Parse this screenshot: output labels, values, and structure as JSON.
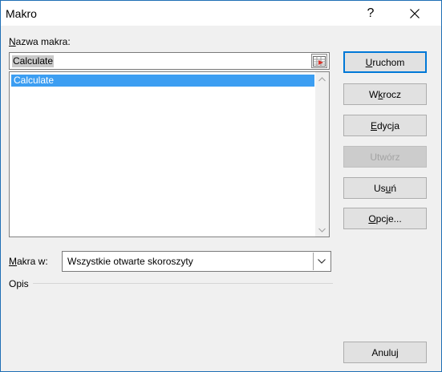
{
  "window": {
    "title": "Makro",
    "help_label": "?",
    "close_icon": "close-icon"
  },
  "macro_name": {
    "label_mnemonic": "N",
    "label_rest": "azwa makra:",
    "value": "Calculate",
    "picker_icon": "collapse-dialog-icon"
  },
  "macro_list": {
    "items": [
      "Calculate"
    ],
    "selected_index": 0
  },
  "location": {
    "label_mnemonic": "M",
    "label_rest": "akra w:",
    "value": "Wszystkie otwarte skoroszyty",
    "dropdown_icon": "chevron-down-icon"
  },
  "description": {
    "label": "Opis"
  },
  "buttons": {
    "run": {
      "mn": "U",
      "rest": "ruchom"
    },
    "step_into_pre": "W",
    "step_into_mn": "k",
    "step_into_post": "rocz",
    "edit": {
      "mn": "E",
      "rest": "dycja"
    },
    "create": {
      "label": "Utwórz"
    },
    "delete_pre": "Us",
    "delete_mn": "u",
    "delete_post": "ń",
    "options": {
      "mn": "O",
      "rest": "pcje..."
    },
    "cancel": {
      "label": "Anuluj"
    }
  },
  "colors": {
    "accent": "#0078d7",
    "selection": "#3c9ef2",
    "dialog_bg": "#f0f0f0"
  }
}
